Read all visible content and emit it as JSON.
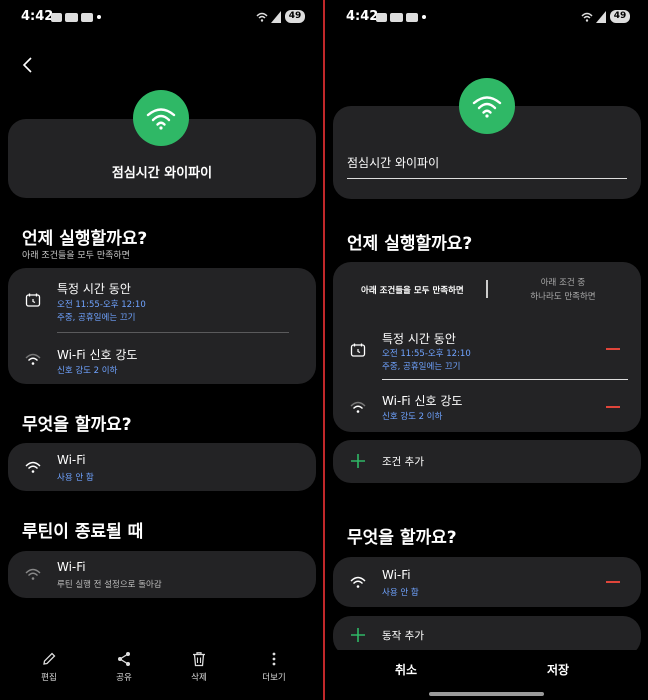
{
  "status_bar": {
    "time": "4:42",
    "battery": "49"
  },
  "left": {
    "routine_name": "점심시간 와이파이",
    "when": {
      "title": "언제 실행할까요?",
      "subtitle": "아래 조건들을 모두 만족하면",
      "conditions": [
        {
          "title": "특정 시간 동안",
          "line1": "오전 11:55-오후 12:10",
          "line2": "주중, 공휴일에는 끄기"
        },
        {
          "title": "Wi-Fi 신호 강도",
          "line1": "신호 강도 2 이하"
        }
      ]
    },
    "what": {
      "title": "무엇을 할까요?",
      "action": {
        "title": "Wi-Fi",
        "value": "사용 안 함"
      }
    },
    "end": {
      "title": "루틴이 종료될 때",
      "action": {
        "title": "Wi-Fi",
        "value": "루틴 실행 전 설정으로 돌아감"
      }
    },
    "bottom_bar": {
      "edit": "편집",
      "share": "공유",
      "delete": "삭제",
      "more": "더보기"
    }
  },
  "right": {
    "name_field": "점심시간 와이파이",
    "when": {
      "title": "언제 실행할까요?",
      "toggle_all": "아래 조건들을 모두 만족하면",
      "toggle_any_line1": "아래 조건 중",
      "toggle_any_line2": "하나라도 만족하면",
      "conditions": [
        {
          "title": "특정 시간 동안",
          "line1": "오전 11:55-오후 12:10",
          "line2": "주중, 공휴일에는 끄기"
        },
        {
          "title": "Wi-Fi 신호 강도",
          "line1": "신호 강도 2 이하"
        }
      ],
      "add_condition": "조건 추가"
    },
    "what": {
      "title": "무엇을 할까요?",
      "action": {
        "title": "Wi-Fi",
        "value": "사용 안 함"
      },
      "add_action": "동작 추가"
    },
    "footer": {
      "cancel": "취소",
      "save": "저장"
    }
  },
  "colors": {
    "accent_green": "#2fb866",
    "card": "#232325",
    "link_blue": "#6fa3ff",
    "remove_red": "#e0453a",
    "divider_red": "#c0282a"
  },
  "icons": [
    "back-arrow-icon",
    "wifi-icon",
    "calendar-clock-icon",
    "wifi-signal-icon",
    "pencil-icon",
    "share-icon",
    "trash-icon",
    "more-vertical-icon",
    "plus-icon",
    "minus-icon"
  ]
}
